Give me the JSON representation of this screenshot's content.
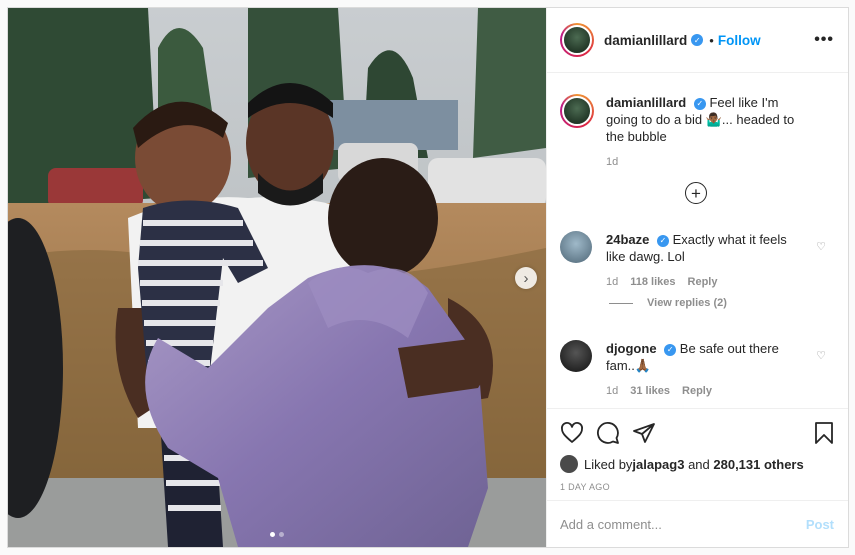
{
  "post": {
    "author": "damianlillard",
    "follow_label": "Follow",
    "dot": "•",
    "more": "•••",
    "caption": "Feel like I'm going to do a bid 🤷🏾‍♂️... headed to the bubble",
    "caption_age": "1d",
    "load_more": "+"
  },
  "comments": [
    {
      "username": "24baze",
      "text": "Exactly what it feels like dawg. Lol",
      "age": "1d",
      "likes": "118 likes",
      "reply_label": "Reply",
      "view_replies": "View replies (2)"
    },
    {
      "username": "djogone",
      "text": "Be safe out there fam..🙏🏾",
      "age": "1d",
      "likes": "31 likes",
      "reply_label": "Reply"
    }
  ],
  "engagement": {
    "liked_by_prefix": "Liked by ",
    "liked_by_user": "jalapag3",
    "liked_by_suffix": " and ",
    "others": "280,131 others",
    "date": "1 DAY AGO"
  },
  "composer": {
    "placeholder": "Add a comment...",
    "post_label": "Post"
  },
  "carousel": {
    "slide_count": 2,
    "active_slide": 1
  },
  "colors": {
    "accent": "#0095f6",
    "verified": "#3897f0",
    "post_disabled": "#b2dffc"
  },
  "icons": [
    "more-options-icon",
    "verified-icon",
    "heart-icon",
    "comment-icon",
    "share-icon",
    "bookmark-icon",
    "plus-circle-icon",
    "next-arrow-icon"
  ]
}
